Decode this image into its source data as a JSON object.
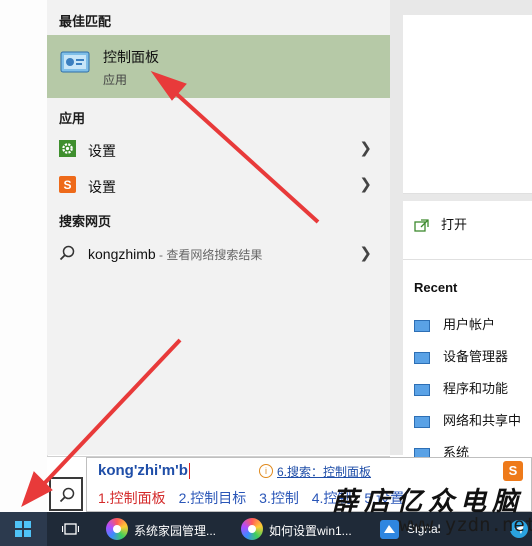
{
  "results": {
    "best_match_header": "最佳匹配",
    "best_match": {
      "title": "控制面板",
      "subtitle": "应用"
    },
    "apps_header": "应用",
    "apps": [
      {
        "label": "设置"
      },
      {
        "label": "设置"
      }
    ],
    "web_header": "搜索网页",
    "web_item": {
      "query": "kongzhimb",
      "suffix": " - 查看网络搜索结果"
    }
  },
  "detail": {
    "open_label": "打开",
    "recent_header": "Recent",
    "recent_items": [
      "用户帐户",
      "设备管理器",
      "程序和功能",
      "网络和共享中",
      "系统"
    ]
  },
  "ime": {
    "composition": "kong'zhi'm'b",
    "hint_icon": "i",
    "hint": "6.搜索：控制面板",
    "candidates": [
      "1.控制面板",
      "2.控制目标",
      "3.控制",
      "4.控制",
      "5.设置"
    ],
    "logo": "S"
  },
  "taskbar": {
    "items": [
      {
        "label": "系统家园管理..."
      },
      {
        "label": "如何设置win1..."
      },
      {
        "label": "Signal"
      }
    ]
  },
  "watermark": {
    "title": "薛店亿众电脑",
    "url": "www.yzdn.net"
  },
  "colors": {
    "highlight": "#b6c9a7",
    "taskbar": "#1f2a38",
    "arrow": "#e83a3a",
    "link": "#1f4ea8"
  },
  "icons": [
    "control-panel-icon",
    "gear-icon",
    "sogou-s-icon",
    "search-icon",
    "chevron-right-icon",
    "open-icon",
    "windows-logo-icon",
    "task-view-icon",
    "browser-swirl-icon",
    "signal-app-icon"
  ]
}
